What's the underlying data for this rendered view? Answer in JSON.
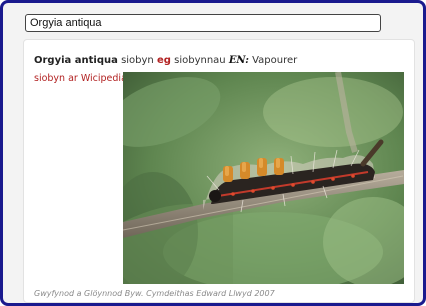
{
  "search": {
    "value": "Orgyia antiqua"
  },
  "entry": {
    "term": "Orgyia antiqua",
    "word1": "siobyn",
    "gender": "eg",
    "word2": "siobynnau",
    "lang_label": "EN:",
    "english": "Vapourer"
  },
  "link": {
    "label": "siobyn ar Wicipedia"
  },
  "image": {
    "subject": "caterpillar-photo"
  },
  "caption": "Gwyfynod a Glöynnod Byw. Cymdeithas Edward Llwyd 2007",
  "colors": {
    "frame": "#1a1a8e",
    "accent": "#b22222"
  }
}
